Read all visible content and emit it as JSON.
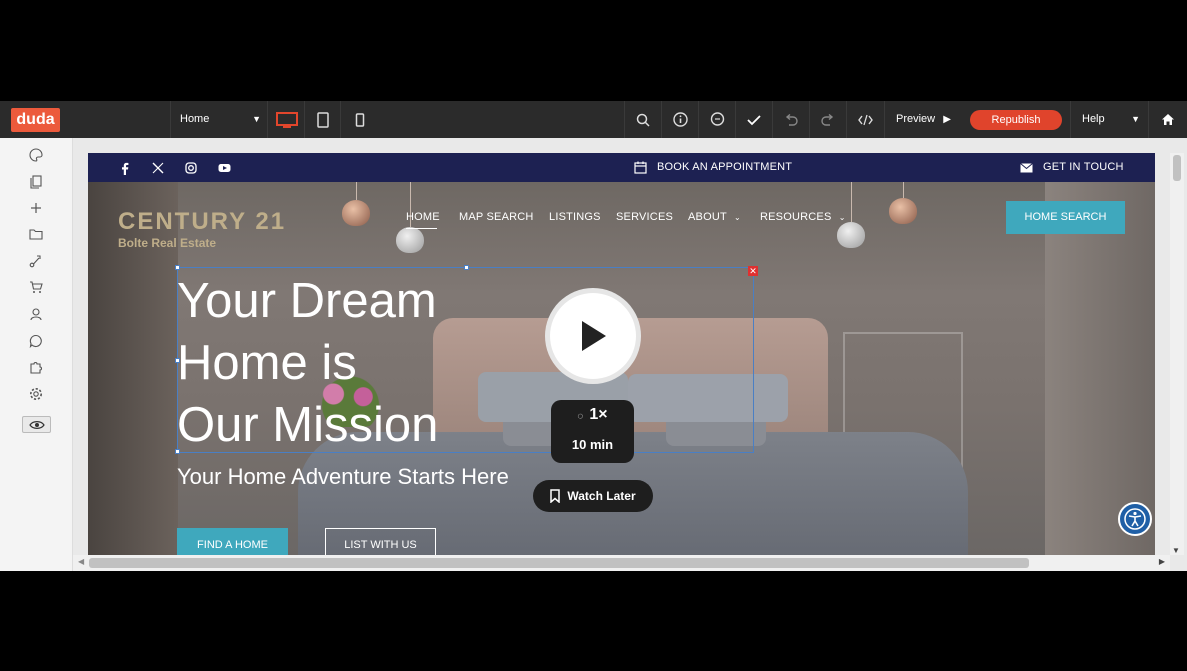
{
  "app": {
    "logo": "duda"
  },
  "toolbar": {
    "page_select": "Home",
    "preview_label": "Preview",
    "republish_label": "Republish",
    "help_label": "Help",
    "device_active": "desktop",
    "icons": [
      "desktop-icon",
      "tablet-icon",
      "mobile-icon",
      "search-icon",
      "info-icon",
      "comment-icon",
      "check-icon",
      "undo-icon",
      "redo-icon",
      "code-icon",
      "home-icon"
    ]
  },
  "sidebar": {
    "icons": [
      "palette-icon",
      "pages-icon",
      "add-icon",
      "folder-icon",
      "flow-icon",
      "cart-icon",
      "user-icon",
      "chat-icon",
      "plugin-icon",
      "settings-icon",
      "eye-icon"
    ]
  },
  "site": {
    "topbar": {
      "social": [
        "facebook-icon",
        "x-icon",
        "instagram-icon",
        "youtube-icon"
      ],
      "appointment": "BOOK AN APPOINTMENT",
      "contact": "GET IN TOUCH"
    },
    "brand": {
      "name": "CENTURY 21",
      "sub": "Bolte Real Estate"
    },
    "nav": [
      "HOME",
      "MAP SEARCH",
      "LISTINGS",
      "SERVICES",
      "ABOUT",
      "RESOURCES"
    ],
    "home_search": "HOME SEARCH",
    "headline": [
      "Your Dream",
      "Home is",
      "Our Mission"
    ],
    "subhead": "Your Home Adventure Starts Here",
    "btn_find": "FIND A HOME",
    "btn_list": "LIST WITH US"
  },
  "video": {
    "speed": "1×",
    "duration": "10 min",
    "watch_later": "Watch Later"
  },
  "colors": {
    "toolbar": "#2b2b2b",
    "brand": "#ec5a3c",
    "republish": "#e0442c",
    "topbar": "#1d2152",
    "accent": "#3fa8bd"
  }
}
